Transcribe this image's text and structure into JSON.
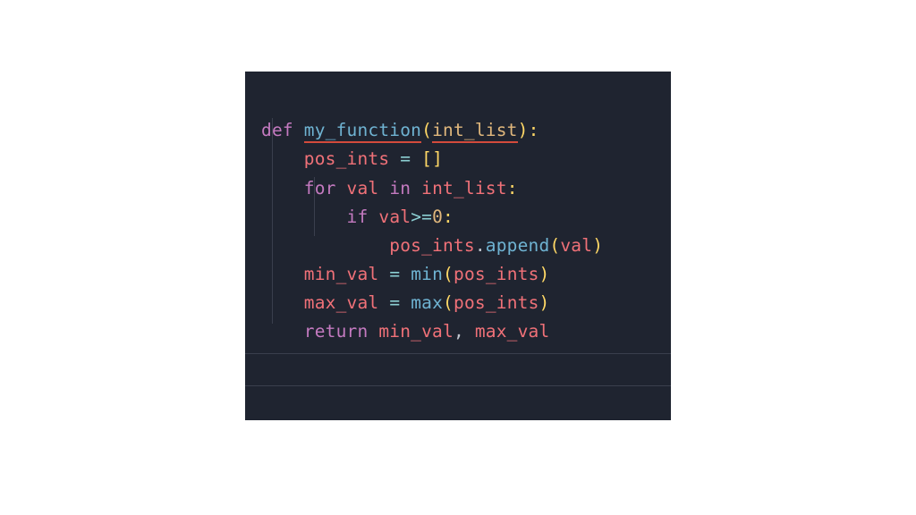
{
  "editor": {
    "theme": {
      "bg": "#1f2430",
      "kw": "#c47ac0",
      "fn": "#6fb3d2",
      "param": "#e0b77c",
      "var": "#f07178",
      "paren": "#ffd866",
      "op": "#8ccfd3",
      "num": "#e0b77c",
      "plain": "#c0c5ce",
      "underline": "#d34b3c"
    },
    "language": "python",
    "tokens": {
      "kw_def": "def",
      "fn_name": "my_function",
      "param": "int_list",
      "var_pos_ints": "pos_ints",
      "op_assign": "=",
      "empty_list_open": "[",
      "empty_list_close": "]",
      "kw_for": "for",
      "var_val": "val",
      "kw_in": "in",
      "var_intlist": "int_list",
      "kw_if": "if",
      "op_gte": ">=",
      "num_zero": "0",
      "method_append": "append",
      "var_min_val": "min_val",
      "var_max_val": "max_val",
      "builtin_min": "min",
      "builtin_max": "max",
      "kw_return": "return",
      "comma": ",",
      "colon": ":",
      "dot": ".",
      "paren_open": "(",
      "paren_close": ")",
      "space": " "
    },
    "source_lines": [
      "def my_function(int_list):",
      "    pos_ints = []",
      "    for val in int_list:",
      "        if val>=0:",
      "            pos_ints.append(val)",
      "    min_val = min(pos_ints)",
      "    max_val = max(pos_ints)",
      "    return min_val, max_val"
    ]
  }
}
